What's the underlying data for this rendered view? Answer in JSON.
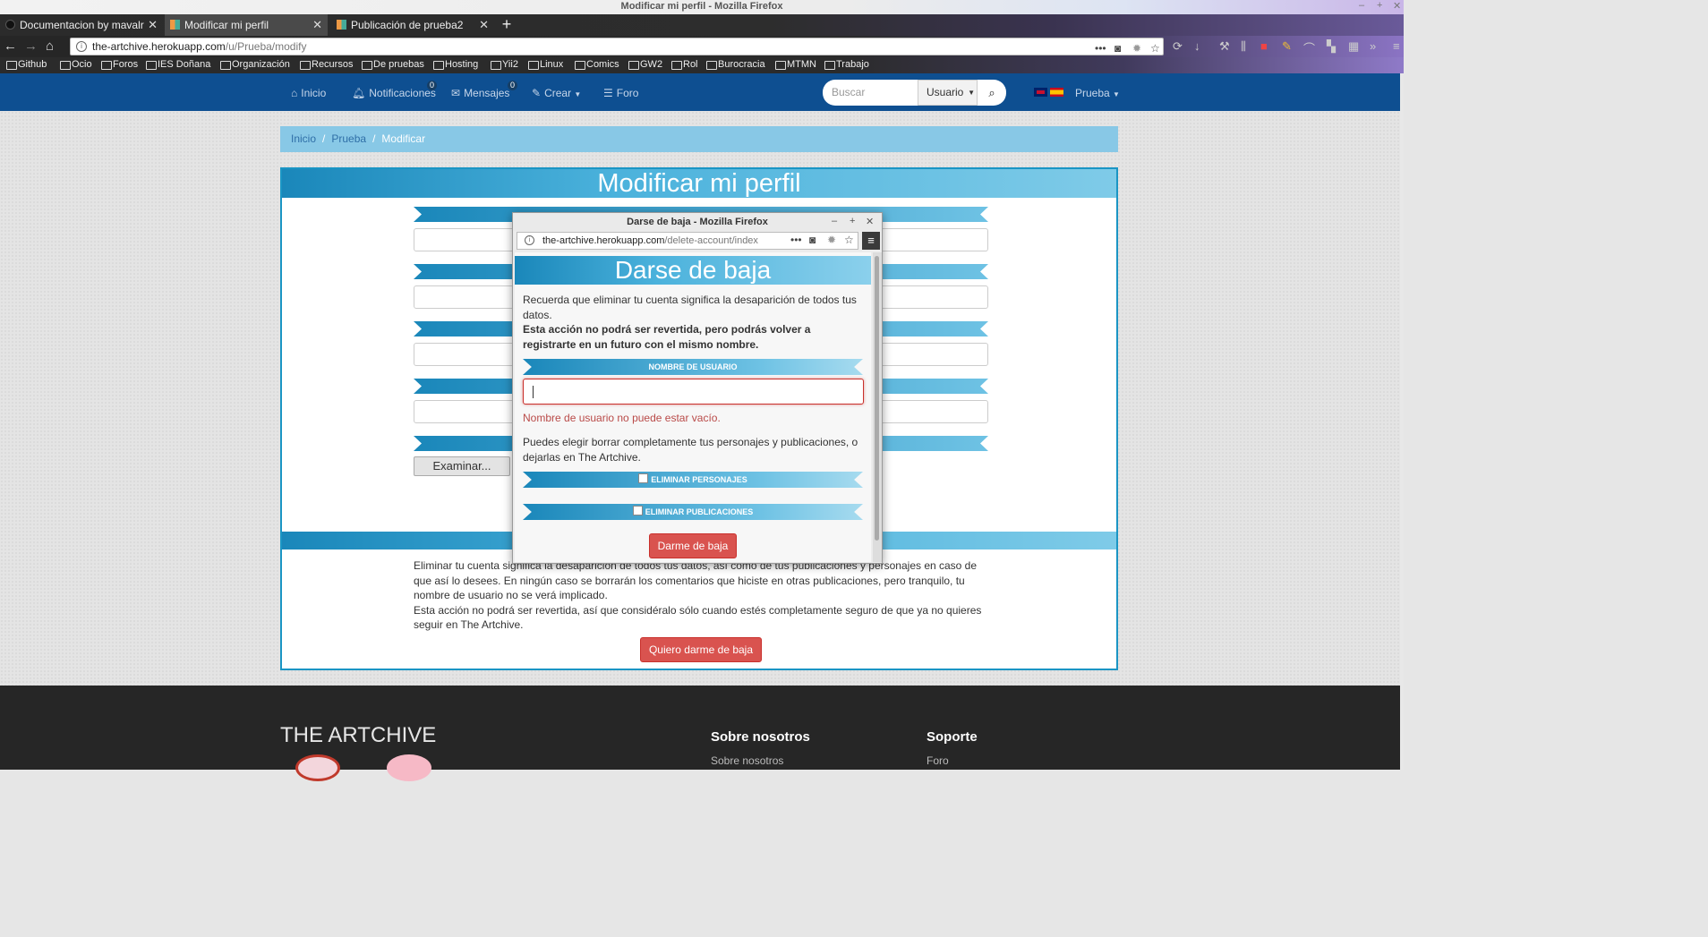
{
  "os": {
    "window_title": "Modificar mi perfil - Mozilla Firefox"
  },
  "browser": {
    "tabs": [
      {
        "label": "Documentacion by mavalr"
      },
      {
        "label": "Modificar mi perfil"
      },
      {
        "label": "Publicación de prueba2"
      }
    ],
    "url_host": "the-artchive.herokuapp.com",
    "url_path": "/u/Prueba/modify",
    "bookmarks": [
      "Github",
      "Ocio",
      "Foros",
      "IES Doñana",
      "Organización",
      "Recursos",
      "De pruebas",
      "Hosting",
      "Yii2",
      "Linux",
      "Comics",
      "GW2",
      "Rol",
      "Burocracia",
      "MTMN",
      "Trabajo"
    ]
  },
  "site_nav": {
    "inicio": "Inicio",
    "notificaciones": "Notificaciones",
    "notificaciones_count": "0",
    "mensajes": "Mensajes",
    "mensajes_count": "0",
    "crear": "Crear",
    "foro": "Foro",
    "search_placeholder": "Buscar",
    "search_scope": "Usuario",
    "user": "Prueba"
  },
  "breadcrumb": {
    "home": "Inicio",
    "user": "Prueba",
    "current": "Modificar"
  },
  "main": {
    "title": "Modificar mi perfil",
    "browse_label": "Examinar...",
    "delete_text": "Eliminar tu cuenta significa la desaparición de todos tus datos, así como de tus publicaciones y personajes en caso de que así lo desees. En ningún caso se borrarán los comentarios que hiciste en otras publicaciones, pero tranquilo, tu nombre de usuario no se verá implicado.",
    "delete_warning": "Esta acción no podrá ser revertida, así que considéralo sólo cuando estés completamente seguro de que ya no quieres seguir en The Artchive.",
    "delete_button": "Quiero darme de baja"
  },
  "footer": {
    "brand": "THE ARTCHIVE",
    "about_title": "Sobre nosotros",
    "about_link": "Sobre nosotros",
    "support_title": "Soporte",
    "support_link": "Foro"
  },
  "popup": {
    "window_title": "Darse de baja - Mozilla Firefox",
    "url_host": "the-artchive.herokuapp.com",
    "url_path": "/delete-account/index",
    "heading": "Darse de baja",
    "intro": "Recuerda que eliminar tu cuenta significa la desaparición de todos tus datos.",
    "warning": "Esta acción no podrá ser revertida, pero podrás volver a registrarte en un futuro con el mismo nombre.",
    "username_label": "NOMBRE DE USUARIO",
    "username_value": "",
    "error": "Nombre de usuario no puede estar vacío.",
    "choice_text": "Puedes elegir borrar completamente tus personajes y publicaciones, o dejarlas en The Artchive.",
    "delete_characters": "ELIMINAR PERSONAJES",
    "delete_publications": "ELIMINAR PUBLICACIONES",
    "submit": "Darme de baja"
  },
  "colors": {
    "site_nav": "#0e4f91",
    "accent": "#1a95c4",
    "danger": "#d9534f"
  }
}
